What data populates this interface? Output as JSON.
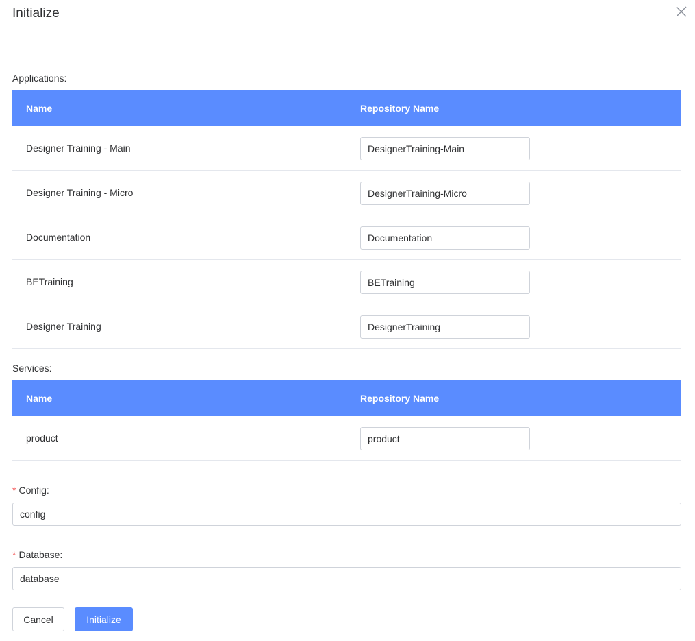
{
  "dialog": {
    "title": "Initialize",
    "close_icon": "close-icon"
  },
  "applications": {
    "label": "Applications:",
    "columns": [
      "Name",
      "Repository Name"
    ],
    "rows": [
      {
        "name": "Designer Training - Main",
        "repo": "DesignerTraining-Main"
      },
      {
        "name": "Designer Training - Micro",
        "repo": "DesignerTraining-Micro"
      },
      {
        "name": "Documentation",
        "repo": "Documentation"
      },
      {
        "name": "BETraining",
        "repo": "BETraining"
      },
      {
        "name": "Designer Training",
        "repo": "DesignerTraining"
      }
    ]
  },
  "services": {
    "label": "Services:",
    "columns": [
      "Name",
      "Repository Name"
    ],
    "rows": [
      {
        "name": "product",
        "repo": "product"
      }
    ]
  },
  "config": {
    "required_mark": "*",
    "label": "Config:",
    "value": "config"
  },
  "database": {
    "required_mark": "*",
    "label": "Database:",
    "value": "database"
  },
  "buttons": {
    "cancel": "Cancel",
    "initialize": "Initialize"
  },
  "colors": {
    "accent": "#5a8cff",
    "required": "#f56c6c"
  }
}
